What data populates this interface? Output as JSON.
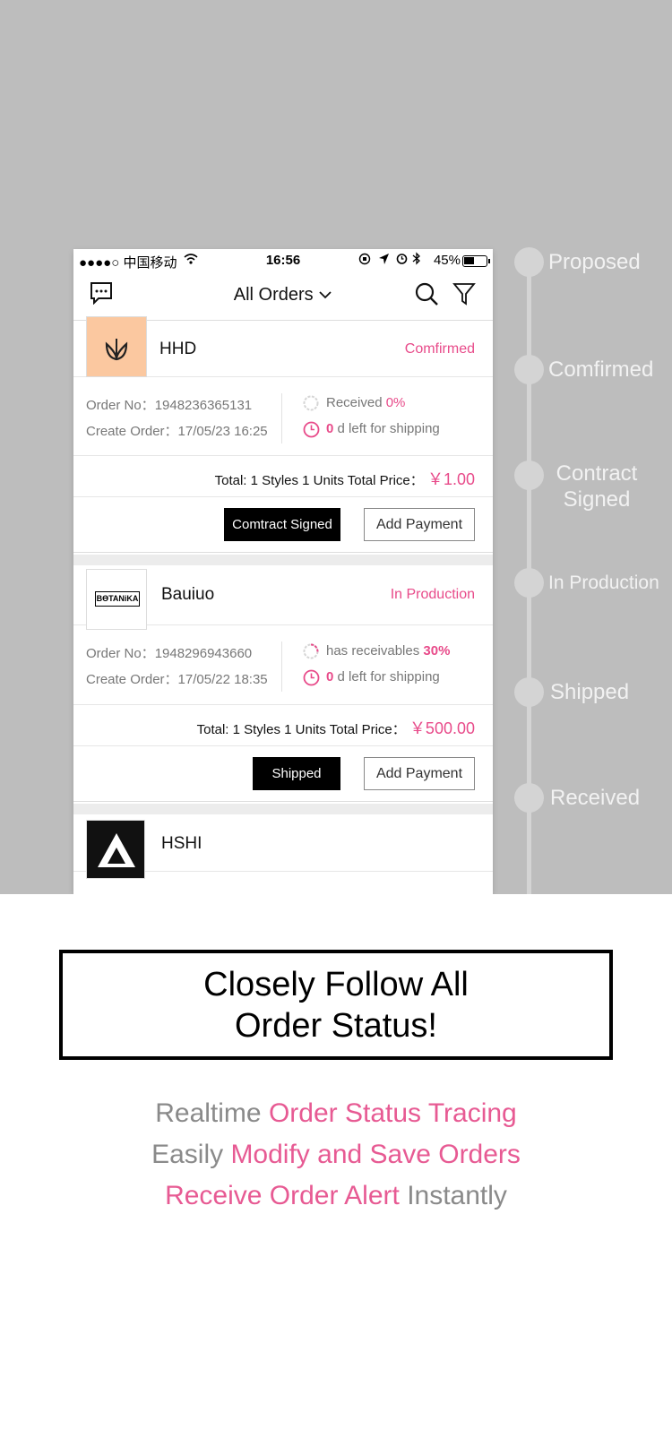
{
  "status_bar": {
    "carrier": "●●●●○ 中国移动",
    "time": "16:56",
    "battery": "45%"
  },
  "nav": {
    "title": "All Orders"
  },
  "orders": [
    {
      "shop": "HHD",
      "status": "Comfirmed",
      "order_no_label": "Order No：",
      "order_no": "1948236365131",
      "create_label": "Create Order：",
      "create_time": "17/05/23 16:25",
      "payment_label": "Received",
      "payment_pct": "0%",
      "days_left": "0",
      "days_text": "d left for shipping",
      "total_label": "Total: 1 Styles 1 Units Total Price：",
      "total_price": "￥1.00",
      "primary_btn": "Comtract Signed",
      "secondary_btn": "Add Payment"
    },
    {
      "shop": "Bauiuo",
      "status": "In Production",
      "logo_text": "BƟTANiKA",
      "order_no_label": "Order No：",
      "order_no": "1948296943660",
      "create_label": "Create Order：",
      "create_time": "17/05/22 18:35",
      "payment_label": "has receivables",
      "payment_pct": "30%",
      "days_left": "0",
      "days_text": "d left for shipping",
      "total_label": "Total: 1 Styles 1 Units Total Price：",
      "total_price": "￥500.00",
      "primary_btn": "Shipped",
      "secondary_btn": "Add Payment"
    },
    {
      "shop": "HSHI"
    }
  ],
  "timeline": [
    "Proposed",
    "Comfirmed",
    "Contract Signed",
    "In Production",
    "Shipped",
    "Received"
  ],
  "headline": {
    "line1": "Closely Follow All",
    "line2": "Order Status!"
  },
  "features": {
    "line1_a": "Realtime ",
    "line1_b": "Order Status Tracing",
    "line2_a": "Easily ",
    "line2_b": "Modify and Save Orders",
    "line3_a": "Receive Order Alert",
    "line3_b": " Instantly"
  },
  "colors": {
    "accent": "#e84b8a",
    "background_gray": "#bdbdbd"
  }
}
